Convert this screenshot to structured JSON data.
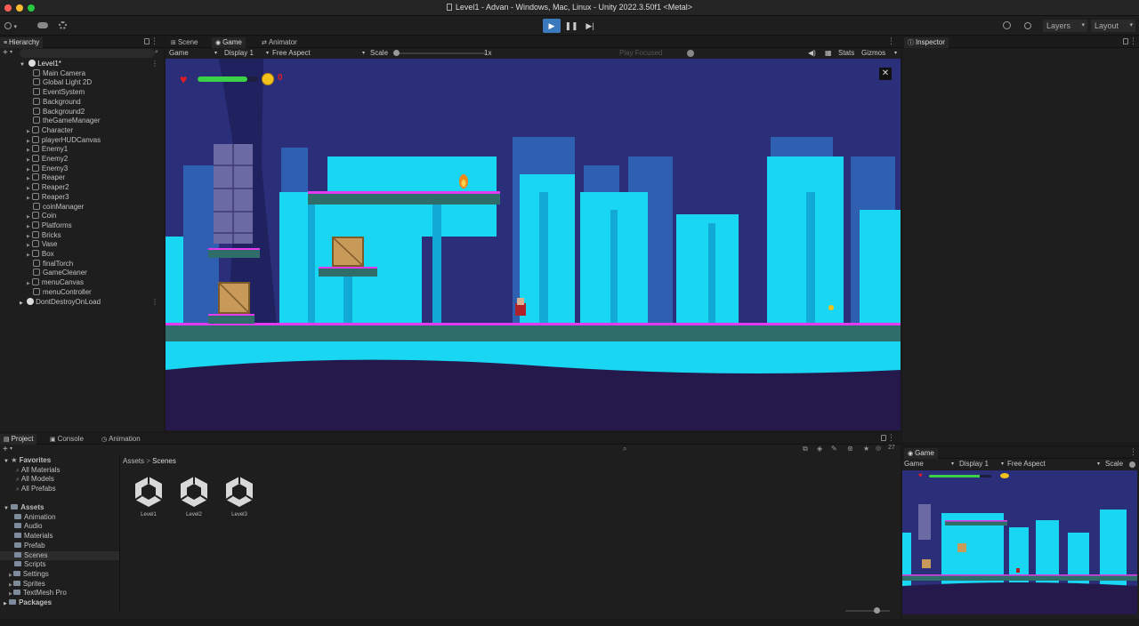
{
  "window": {
    "title": "Level1 - Advan - Windows, Mac, Linux - Unity 2022.3.50f1 <Metal>"
  },
  "toolbar": {
    "layers_label": "Layers",
    "layout_label": "Layout"
  },
  "hierarchy": {
    "tab_label": "Hierarchy",
    "scene_name": "Level1*",
    "items": [
      "Main Camera",
      "Global Light 2D",
      "EventSystem",
      "Background",
      "Background2",
      "theGameManager",
      "Character",
      "playerHUDCanvas",
      "Enemy1",
      "Enemy2",
      "Enemy3",
      "Reaper",
      "Reaper2",
      "Reaper3",
      "coinManager",
      "Coin",
      "Platforms",
      "Bricks",
      "Vase",
      "Box",
      "finalTorch",
      "GameCleaner",
      "menuCanvas",
      "menuController"
    ],
    "dont_destroy": "DontDestroyOnLoad"
  },
  "center_tabs": {
    "scene": "Scene",
    "game": "Game",
    "animator": "Animator"
  },
  "game_bar": {
    "mode": "Game",
    "display": "Display 1",
    "aspect": "Free Aspect",
    "scale_label": "Scale",
    "scale_value": "1x",
    "play_focused": "Play Focused",
    "stats": "Stats",
    "gizmos": "Gizmos"
  },
  "hud": {
    "health_fraction": 0.82,
    "coin_count": "0"
  },
  "inspector": {
    "tab_label": "Inspector"
  },
  "bottom_tabs": {
    "project": "Project",
    "console": "Console",
    "animation": "Animation"
  },
  "project": {
    "favorites_label": "Favorites",
    "favorites": [
      "All Materials",
      "All Models",
      "All Prefabs"
    ],
    "assets_label": "Assets",
    "folders": [
      "Animation",
      "Audio",
      "Materials",
      "Prefab",
      "Scenes",
      "Scripts",
      "Settings",
      "Sprites",
      "TextMesh Pro"
    ],
    "packages_label": "Packages",
    "breadcrumb_root": "Assets",
    "breadcrumb_current": "Scenes",
    "item_count": "27",
    "scenes": [
      "Level1",
      "Level2",
      "Level3"
    ]
  },
  "mini_game": {
    "tab_label": "Game",
    "mode": "Game",
    "display": "Display 1",
    "aspect": "Free Aspect",
    "scale_label": "Scale"
  },
  "colors": {
    "accent": "#3a79bb",
    "sky": "#2b2f7a",
    "trees_cyan": "#19d6f2",
    "platform_magenta": "#e23af0",
    "health_green": "#3bd24a"
  }
}
